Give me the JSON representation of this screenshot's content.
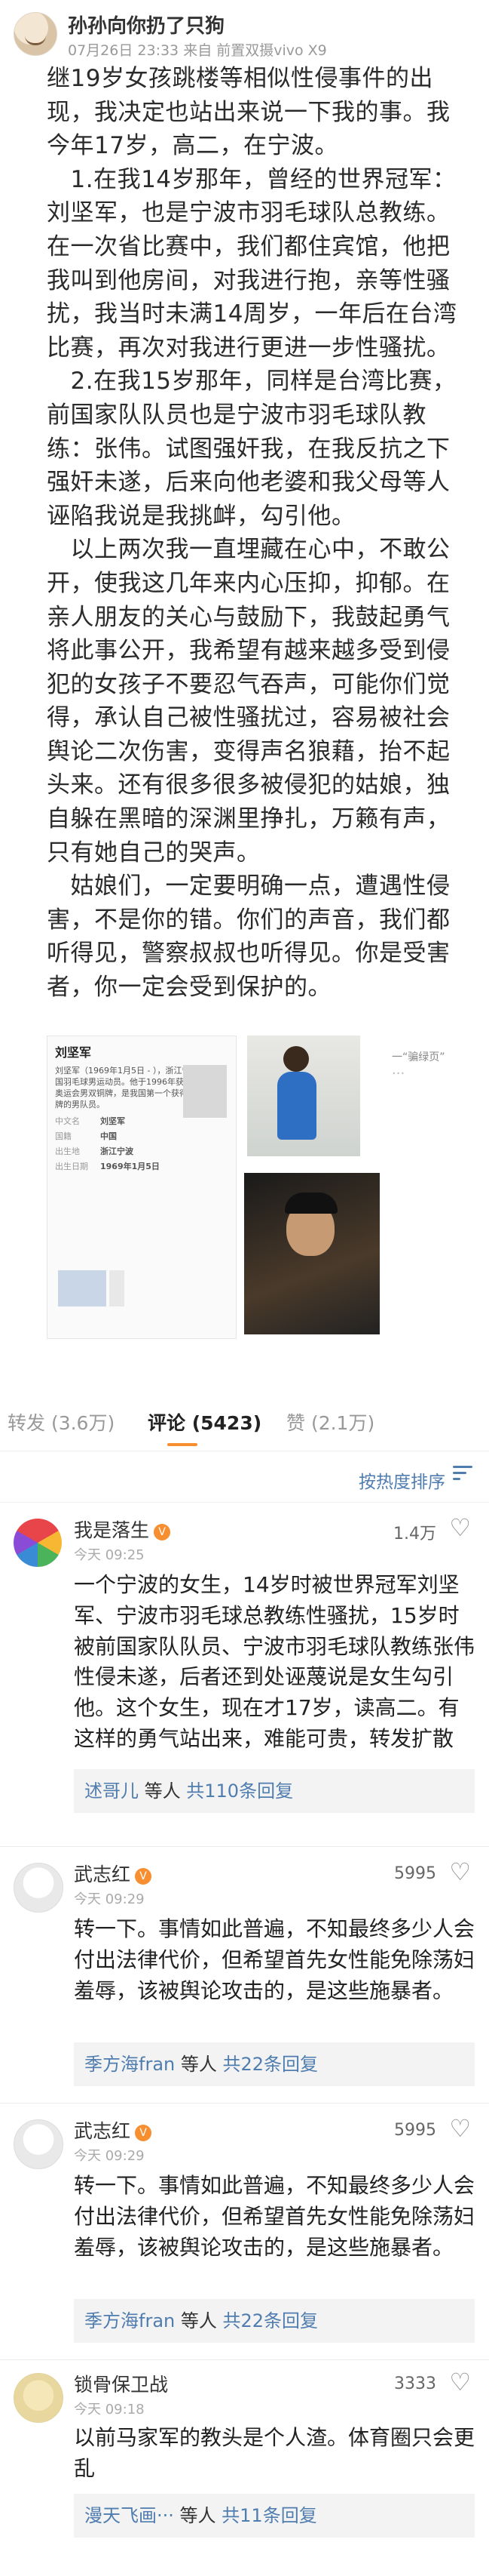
{
  "post": {
    "author": "孙孙向你扔了只狗",
    "meta": "07月26日 23:33 来自 前置双摄vivo X9",
    "paragraphs": [
      "继19岁女孩跳楼等相似性侵事件的出现，我决定也站出来说一下我的事。我今年17岁，高二，在宁波。",
      "　1.在我14岁那年，曾经的世界冠军：刘坚军，也是宁波市羽毛球队总教练。在一次省比赛中，我们都住宾馆，他把我叫到他房间，对我进行抱，亲等性骚扰，我当时未满14周岁，一年后在台湾比赛，再次对我进行更进一步性骚扰。",
      "　2.在我15岁那年，同样是台湾比赛，前国家队队员也是宁波市羽毛球队教练：张伟。试图强奸我，在我反抗之下强奸未遂，后来向他老婆和我父母等人诬陷我说是我挑衅，勾引他。",
      "　以上两次我一直埋藏在心中，不敢公开，使我这几年来内心压抑，抑郁。在亲人朋友的关心与鼓励下，我鼓起勇气将此事公开，我希望有越来越多受到侵犯的女孩子不要忍气吞声，可能你们觉得，承认自己被性骚扰过，容易被社会舆论二次伤害，变得声名狼藉，抬不起头来。还有很多很多被侵犯的姑娘，独自躲在黑暗的深渊里挣扎，万籁有声，只有她自己的哭声。",
      "　姑娘们，一定要明确一点，遭遇性侵害，不是你的错。你们的声音，我们都听得见，警察叔叔也听得见。你是受害者，你一定会受到保护的。"
    ]
  },
  "images": {
    "baike_title": "刘坚军",
    "baike_desc": "刘坚军（1969年1月5日 - ），浙江宁波人，中国羽毛球男运动员。他于1996年获得亚特兰大奥运会男双铜牌，是我国第一个获得奥运会奖牌的男队员。",
    "baike_rows": [
      {
        "k": "中文名",
        "v": "刘坚军"
      },
      {
        "k": "国籍",
        "v": "中国"
      },
      {
        "k": "出生地",
        "v": "浙江宁波"
      },
      {
        "k": "出生日期",
        "v": "1969年1月5日"
      }
    ],
    "photo_caption": "一“骗绿页”",
    "photo_dots": "···"
  },
  "tabs": {
    "repost": "转发 (3.6万)",
    "comments": "评论 (5423)",
    "likes": "赞 (2.1万)",
    "sort_label": "按热度排序"
  },
  "comments": [
    {
      "name": "我是落生",
      "time": "今天 09:25",
      "likes": "1.4万",
      "text": "一个宁波的女生，14岁时被世界冠军刘坚军、宁波市羽毛球总教练性骚扰，15岁时被前国家队队员、宁波市羽毛球队教练张伟性侵未遂，后者还到处诬蔑说是女生勾引他。这个女生，现在才17岁，读高二。有这样的勇气站出来，难能可贵，转发扩散",
      "reply_who": "述哥儿",
      "reply_mid": " 等人 ",
      "reply_count": "共110条回复"
    },
    {
      "name": "武志红",
      "time": "今天 09:29",
      "likes": "5995",
      "text": "转一下。事情如此普遍，不知最终多少人会付出法律代价，但希望首先女性能免除荡妇羞辱，该被舆论攻击的，是这些施暴者。",
      "reply_who": "季方海fran",
      "reply_mid": " 等人 ",
      "reply_count": "共22条回复"
    },
    {
      "name": "武志红",
      "time": "今天 09:29",
      "likes": "5995",
      "text": "转一下。事情如此普遍，不知最终多少人会付出法律代价，但希望首先女性能免除荡妇羞辱，该被舆论攻击的，是这些施暴者。",
      "reply_who": "季方海fran",
      "reply_mid": " 等人 ",
      "reply_count": "共22条回复"
    },
    {
      "name": "锁骨保卫战",
      "time": "今天 09:18",
      "likes": "3333",
      "text": "以前马家军的教头是个人渣。体育圈只会更乱",
      "reply_who": "漫天飞画···",
      "reply_mid": " 等人 ",
      "reply_count": "共11条回复"
    }
  ],
  "colors": {
    "accent": "#f78e2f",
    "link": "#507daf"
  }
}
